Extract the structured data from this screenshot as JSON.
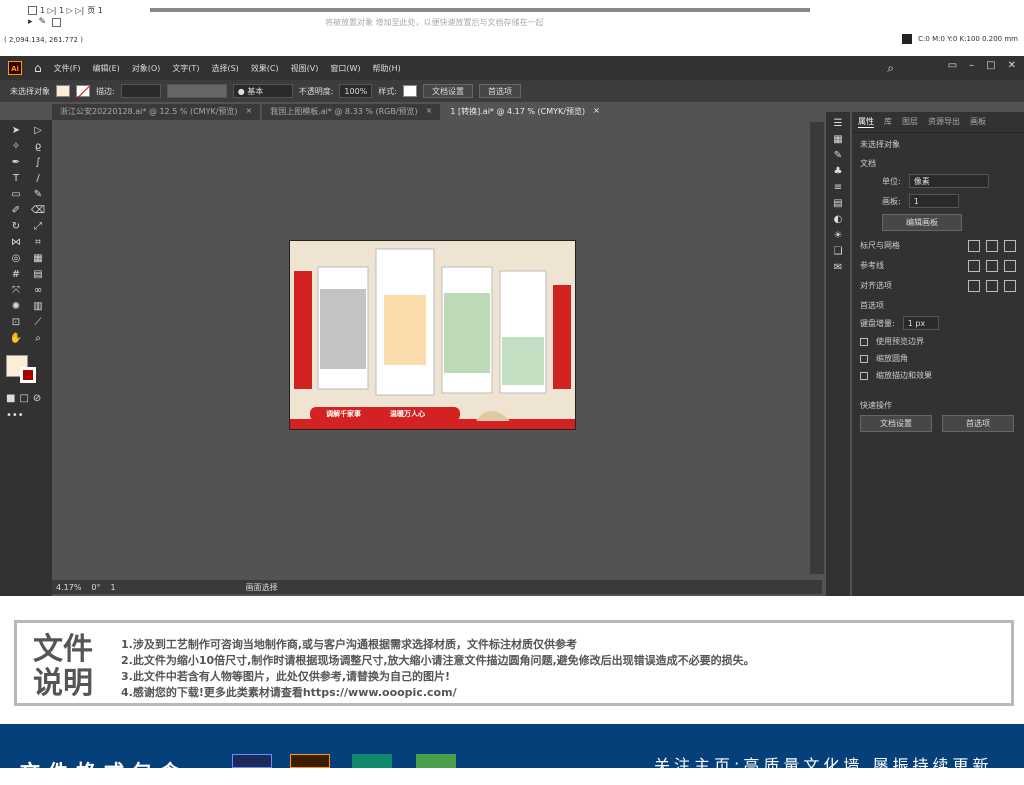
{
  "top": {
    "nav_text": "1  ▷| 1 ▷ ▷|",
    "page_label": "页 1",
    "hint": "将被放置对象 增加至此处，以便快速放置后与文档存储在一起",
    "coords": "( 2,094.134, 261.772 )",
    "color_info": "C:0 M:0 Y:0 K:100 0.200 mm"
  },
  "menu": {
    "logo": "Ai",
    "items": [
      "文件(F)",
      "编辑(E)",
      "对象(O)",
      "文字(T)",
      "选择(S)",
      "效果(C)",
      "视图(V)",
      "窗口(W)",
      "帮助(H)"
    ]
  },
  "control": {
    "no_selection": "未选择对象",
    "stroke_label": "描边:",
    "brush": "● 基本",
    "opacity_label": "不透明度:",
    "opacity": "100%",
    "style_label": "样式:",
    "doc_setup": "文档设置",
    "prefs": "首选项"
  },
  "tabs": [
    {
      "label": "浙江公安20220128.ai* @ 12.5 % (CMYK/预览)",
      "active": false
    },
    {
      "label": "我国上图模板.ai* @ 8.33 % (RGB/预览)",
      "active": false
    },
    {
      "label": "1 [转换].ai* @ 4.17 % (CMYK/预览)",
      "active": true
    }
  ],
  "status": {
    "zoom": "4.17%",
    "rotation": "0°",
    "page": "1",
    "tool": "画面选择"
  },
  "panel": {
    "tabs": [
      "属性",
      "库",
      "图层",
      "资源导出",
      "画板"
    ],
    "no_selection": "未选择对象",
    "doc_section": "文档",
    "units_label": "单位:",
    "units": "像素",
    "artboard_label": "画板:",
    "artboard": "1",
    "edit_artboards": "编辑画板",
    "rulers_grids": "标尺与网格",
    "guides": "参考线",
    "align_to": "对齐选项",
    "prefs_section": "首选项",
    "keyboard_inc_label": "键盘增量:",
    "keyboard_inc": "1 px",
    "opt1": "使用预览边界",
    "opt2": "缩放圆角",
    "opt3": "缩放描边和效果",
    "quick_actions": "快速操作",
    "doc_setup": "文档设置",
    "prefs": "首选项"
  },
  "info": {
    "title_line1": "文件",
    "title_line2": "说明",
    "lines": [
      "1.涉及到工艺制作可咨询当地制作商,或与客户沟通根据需求选择材质，文件标注材质仅供参考",
      "2.此文件为缩小10倍尺寸,制作时请根据现场调整尺寸,放大缩小请注意文件描边圆角问题,避免修改后出现错误造成不必要的损失。",
      "3.此文件中若含有人物等图片，此处仅供参考,请替换为自己的图片!",
      "4.感谢您的下载!更多此类素材请查看https://www.ooopic.com/"
    ]
  },
  "footer": {
    "left": "文件格式包含",
    "right": "关注主页:高质量文化墙 屡振持续更新"
  },
  "artboard": {
    "banner1": "调解千家事",
    "banner2": "温暖万人心"
  },
  "colors": {
    "accent_red": "#d32222",
    "beige": "#efe4d2",
    "panel_bg": "#323232"
  }
}
